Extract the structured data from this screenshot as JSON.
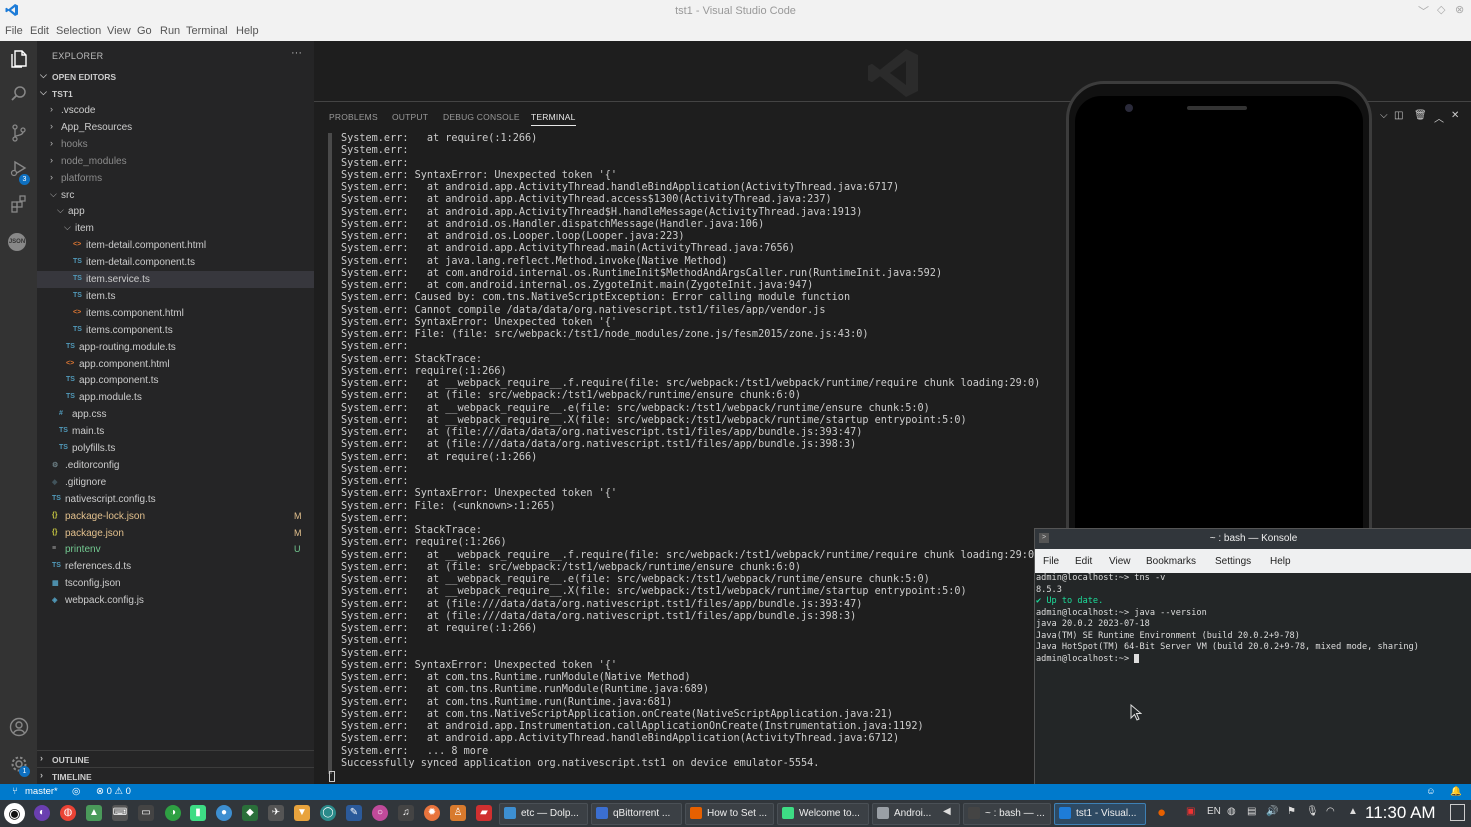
{
  "window": {
    "title": "tst1 - Visual Studio Code"
  },
  "menu": [
    "File",
    "Edit",
    "Selection",
    "View",
    "Go",
    "Run",
    "Terminal",
    "Help"
  ],
  "activity": {
    "scm_badge": "3",
    "settings_badge": "1",
    "json_label": "JSON"
  },
  "sidebar": {
    "header": "EXPLORER",
    "more": "···",
    "open_editors": "OPEN EDITORS",
    "root": "TST1",
    "outline": "OUTLINE",
    "timeline": "TIMELINE",
    "tree": [
      {
        "name": ".vscode",
        "type": "folder",
        "expanded": false
      },
      {
        "name": "App_Resources",
        "type": "folder",
        "expanded": false
      },
      {
        "name": "hooks",
        "type": "folder",
        "expanded": false,
        "dim": true
      },
      {
        "name": "node_modules",
        "type": "folder",
        "expanded": false,
        "dim": true
      },
      {
        "name": "platforms",
        "type": "folder",
        "expanded": false,
        "dim": true
      },
      {
        "name": "src",
        "type": "folder",
        "expanded": true
      },
      {
        "name": "app",
        "type": "folder",
        "expanded": true
      },
      {
        "name": "item",
        "type": "folder",
        "expanded": true
      },
      {
        "name": "item-detail.component.html",
        "type": "html"
      },
      {
        "name": "item-detail.component.ts",
        "type": "ts"
      },
      {
        "name": "item.service.ts",
        "type": "ts",
        "selected": true
      },
      {
        "name": "item.ts",
        "type": "ts"
      },
      {
        "name": "items.component.html",
        "type": "html"
      },
      {
        "name": "items.component.ts",
        "type": "ts"
      },
      {
        "name": "app-routing.module.ts",
        "type": "ts"
      },
      {
        "name": "app.component.html",
        "type": "html"
      },
      {
        "name": "app.component.ts",
        "type": "ts"
      },
      {
        "name": "app.module.ts",
        "type": "ts"
      },
      {
        "name": "app.css",
        "type": "css"
      },
      {
        "name": "main.ts",
        "type": "ts"
      },
      {
        "name": "polyfills.ts",
        "type": "ts"
      },
      {
        "name": ".editorconfig",
        "type": "gear"
      },
      {
        "name": ".gitignore",
        "type": "git"
      },
      {
        "name": "nativescript.config.ts",
        "type": "ts"
      },
      {
        "name": "package-lock.json",
        "type": "json",
        "git": "M"
      },
      {
        "name": "package.json",
        "type": "json",
        "git": "M"
      },
      {
        "name": "printenv",
        "type": "text",
        "git": "U"
      },
      {
        "name": "references.d.ts",
        "type": "ts"
      },
      {
        "name": "tsconfig.json",
        "type": "tsconfig"
      },
      {
        "name": "webpack.config.js",
        "type": "webpack"
      }
    ],
    "icon_labels": {
      "ts": "TS",
      "html": "<>",
      "json": "{}",
      "css": "#",
      "gear": "⚙",
      "git": "◆",
      "text": "≡",
      "tsconfig": "▦",
      "webpack": "◈"
    }
  },
  "panel": {
    "tabs": [
      "PROBLEMS",
      "OUTPUT",
      "DEBUG CONSOLE",
      "TERMINAL"
    ],
    "active_tab": "TERMINAL",
    "terminal_lines": [
      "System.err:   at require(:1:266)",
      "System.err:",
      "System.err:",
      "System.err: SyntaxError: Unexpected token '{'",
      "System.err:   at android.app.ActivityThread.handleBindApplication(ActivityThread.java:6717)",
      "System.err:   at android.app.ActivityThread.access$1300(ActivityThread.java:237)",
      "System.err:   at android.app.ActivityThread$H.handleMessage(ActivityThread.java:1913)",
      "System.err:   at android.os.Handler.dispatchMessage(Handler.java:106)",
      "System.err:   at android.os.Looper.loop(Looper.java:223)",
      "System.err:   at android.app.ActivityThread.main(ActivityThread.java:7656)",
      "System.err:   at java.lang.reflect.Method.invoke(Native Method)",
      "System.err:   at com.android.internal.os.RuntimeInit$MethodAndArgsCaller.run(RuntimeInit.java:592)",
      "System.err:   at com.android.internal.os.ZygoteInit.main(ZygoteInit.java:947)",
      "System.err: Caused by: com.tns.NativeScriptException: Error calling module function",
      "System.err: Cannot compile /data/data/org.nativescript.tst1/files/app/vendor.js",
      "System.err: SyntaxError: Unexpected token '{'",
      "System.err: File: (file: src/webpack:/tst1/node_modules/zone.js/fesm2015/zone.js:43:0)",
      "System.err:",
      "System.err: StackTrace:",
      "System.err: require(:1:266)",
      "System.err:   at __webpack_require__.f.require(file: src/webpack:/tst1/webpack/runtime/require chunk loading:29:0)",
      "System.err:   at (file: src/webpack:/tst1/webpack/runtime/ensure chunk:6:0)",
      "System.err:   at __webpack_require__.e(file: src/webpack:/tst1/webpack/runtime/ensure chunk:5:0)",
      "System.err:   at __webpack_require__.X(file: src/webpack:/tst1/webpack/runtime/startup entrypoint:5:0)",
      "System.err:   at (file:///data/data/org.nativescript.tst1/files/app/bundle.js:393:47)",
      "System.err:   at (file:///data/data/org.nativescript.tst1/files/app/bundle.js:398:3)",
      "System.err:   at require(:1:266)",
      "System.err:",
      "System.err:",
      "System.err: SyntaxError: Unexpected token '{'",
      "System.err: File: (<unknown>:1:265)",
      "System.err:",
      "System.err: StackTrace:",
      "System.err: require(:1:266)",
      "System.err:   at __webpack_require__.f.require(file: src/webpack:/tst1/webpack/runtime/require chunk loading:29:0)",
      "System.err:   at (file: src/webpack:/tst1/webpack/runtime/ensure chunk:6:0)",
      "System.err:   at __webpack_require__.e(file: src/webpack:/tst1/webpack/runtime/ensure chunk:5:0)",
      "System.err:   at __webpack_require__.X(file: src/webpack:/tst1/webpack/runtime/startup entrypoint:5:0)",
      "System.err:   at (file:///data/data/org.nativescript.tst1/files/app/bundle.js:393:47)",
      "System.err:   at (file:///data/data/org.nativescript.tst1/files/app/bundle.js:398:3)",
      "System.err:   at require(:1:266)",
      "System.err:",
      "System.err:",
      "System.err: SyntaxError: Unexpected token '{'",
      "System.err:   at com.tns.Runtime.runModule(Native Method)",
      "System.err:   at com.tns.Runtime.runModule(Runtime.java:689)",
      "System.err:   at com.tns.Runtime.run(Runtime.java:681)",
      "System.err:   at com.tns.NativeScriptApplication.onCreate(NativeScriptApplication.java:21)",
      "System.err:   at android.app.Instrumentation.callApplicationOnCreate(Instrumentation.java:1192)",
      "System.err:   at android.app.ActivityThread.handleBindApplication(ActivityThread.java:6712)",
      "System.err:   ... 8 more",
      "Successfully synced application org.nativescript.tst1 on device emulator-5554."
    ]
  },
  "konsole": {
    "title": "~ : bash — Konsole",
    "menu": [
      "File",
      "Edit",
      "View",
      "Bookmarks",
      "Settings",
      "Help"
    ],
    "lines": [
      {
        "text": "admin@localhost:~> tns -v"
      },
      {
        "text": "8.5.3"
      },
      {
        "text": "✔ Up to date.",
        "ok": true
      },
      {
        "text": "admin@localhost:~> java --version"
      },
      {
        "text": "java 20.0.2 2023-07-18"
      },
      {
        "text": "Java(TM) SE Runtime Environment (build 20.0.2+9-78)"
      },
      {
        "text": "Java HotSpot(TM) 64-Bit Server VM (build 20.0.2+9-78, mixed mode, sharing)"
      },
      {
        "text": "admin@localhost:~> ",
        "cursor": true
      }
    ]
  },
  "statusbar": {
    "branch": "master*",
    "problems": "⊗ 0 ⚠ 0"
  },
  "taskbar": {
    "tasks": [
      {
        "label": "etc — Dolp...",
        "color": "#3d8fd1"
      },
      {
        "label": "qBittorrent ...",
        "color": "#3b6fd1"
      },
      {
        "label": "How to Set ...",
        "color": "#e66000"
      },
      {
        "label": "Welcome to...",
        "color": "#3ddc84"
      },
      {
        "label": "Androi...",
        "color": "#9aa0a6"
      },
      {
        "label": "~ : bash — ...",
        "color": "#444"
      },
      {
        "label": "tst1 - Visual...",
        "color": "#1e7cd8",
        "active": true
      }
    ],
    "lang": "EN",
    "clock": "11:30 AM"
  }
}
